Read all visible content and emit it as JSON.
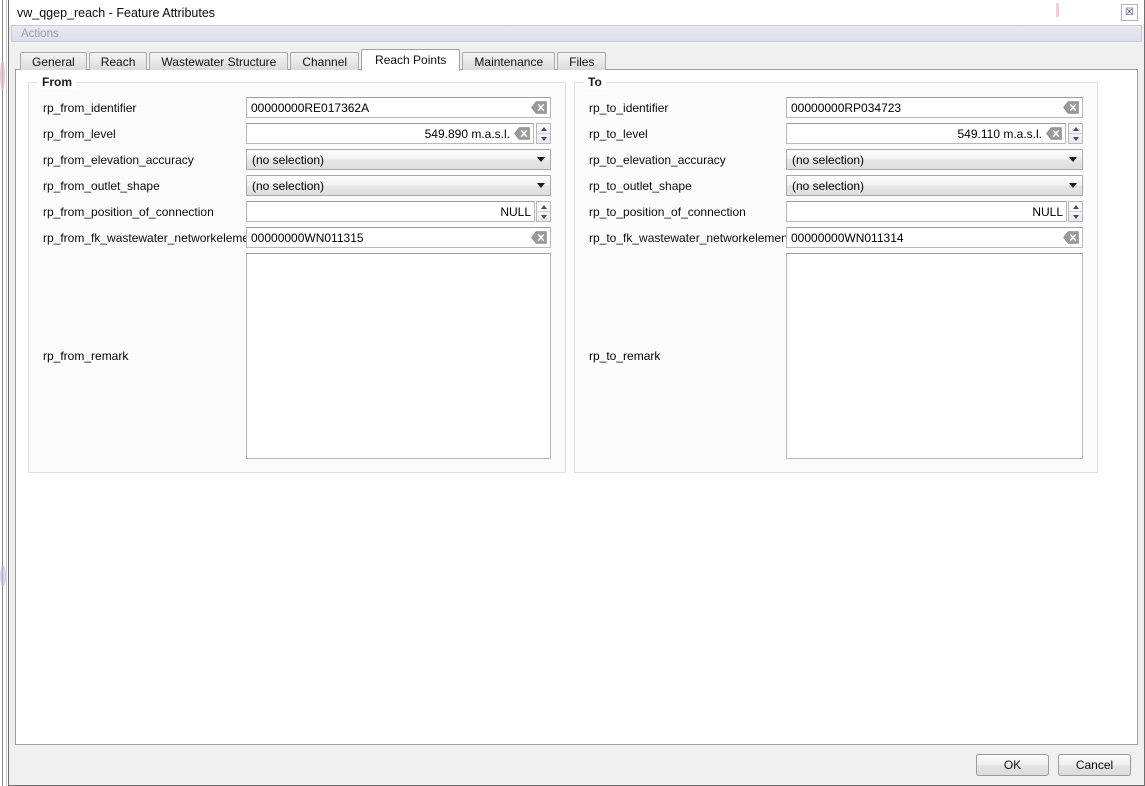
{
  "window": {
    "title": "vw_qgep_reach - Feature Attributes",
    "close_icon": "close-icon",
    "close_glyph": "☒"
  },
  "actions": {
    "label": "Actions"
  },
  "tabs": [
    {
      "label": "General",
      "active": false
    },
    {
      "label": "Reach",
      "active": false
    },
    {
      "label": "Wastewater Structure",
      "active": false
    },
    {
      "label": "Channel",
      "active": false
    },
    {
      "label": "Reach Points",
      "active": true
    },
    {
      "label": "Maintenance",
      "active": false
    },
    {
      "label": "Files",
      "active": false
    }
  ],
  "from_group": {
    "title": "From",
    "fields": [
      {
        "label": "rp_from_identifier",
        "type": "lineedit",
        "value": "00000000RE017362A",
        "align": "left",
        "clear_icon": "clear-value-icon"
      },
      {
        "label": "rp_from_level",
        "type": "lineedit-spin",
        "value": "549.890 m.a.s.l.",
        "align": "right",
        "clear_icon": "clear-value-icon"
      },
      {
        "label": "rp_from_elevation_accuracy",
        "type": "combo",
        "value": "(no selection)"
      },
      {
        "label": "rp_from_outlet_shape",
        "type": "combo",
        "value": "(no selection)"
      },
      {
        "label": "rp_from_position_of_connection",
        "type": "spin",
        "value": "NULL",
        "align": "right"
      },
      {
        "label": "rp_from_fk_wastewater_networkelement",
        "type": "lineedit",
        "value": "00000000WN011315",
        "align": "left",
        "clear_icon": "clear-value-icon"
      }
    ],
    "remark": {
      "label": "rp_from_remark",
      "value": ""
    }
  },
  "to_group": {
    "title": "To",
    "fields": [
      {
        "label": "rp_to_identifier",
        "type": "lineedit",
        "value": "00000000RP034723",
        "align": "left",
        "clear_icon": "clear-value-icon"
      },
      {
        "label": "rp_to_level",
        "type": "lineedit-spin",
        "value": "549.110 m.a.s.l.",
        "align": "right",
        "clear_icon": "clear-value-icon"
      },
      {
        "label": "rp_to_elevation_accuracy",
        "type": "combo",
        "value": "(no selection)"
      },
      {
        "label": "rp_to_outlet_shape",
        "type": "combo",
        "value": "(no selection)"
      },
      {
        "label": "rp_to_position_of_connection",
        "type": "spin",
        "value": "NULL",
        "align": "right"
      },
      {
        "label": "rp_to_fk_wastewater_networkelement",
        "type": "lineedit",
        "value": "00000000WN011314",
        "align": "left",
        "clear_icon": "clear-value-icon"
      }
    ],
    "remark": {
      "label": "rp_to_remark",
      "value": ""
    }
  },
  "buttons": {
    "ok": "OK",
    "cancel": "Cancel"
  },
  "colors": {
    "window_bg": "#f0f0f0",
    "page_bg": "#ffffff",
    "actions_bar": "#e2e5ef",
    "border": "#a0a0a0",
    "text": "#0c0c0c"
  }
}
